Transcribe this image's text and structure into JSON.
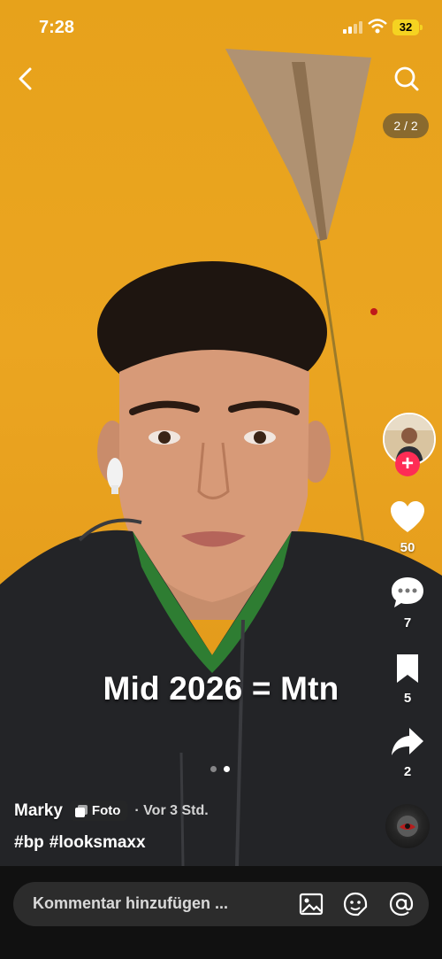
{
  "status_bar": {
    "time": "7:28",
    "battery": "32"
  },
  "top_nav": {
    "counter": "2 / 2"
  },
  "post": {
    "caption": "Mid 2026 = Mtn",
    "author": "Marky",
    "type_badge": "Foto",
    "time_ago": "· Vor 3 Std.",
    "hashtags": [
      "#bp",
      "#looksmaxx"
    ],
    "slide_count": 2,
    "active_slide": 2
  },
  "actions": {
    "likes": "50",
    "comments": "7",
    "saves": "5",
    "shares": "2"
  },
  "comment_bar": {
    "placeholder": "Kommentar hinzufügen ..."
  },
  "colors": {
    "follow": "#fe2c55",
    "background": "#e9a31e",
    "battery": "#f5d321"
  }
}
